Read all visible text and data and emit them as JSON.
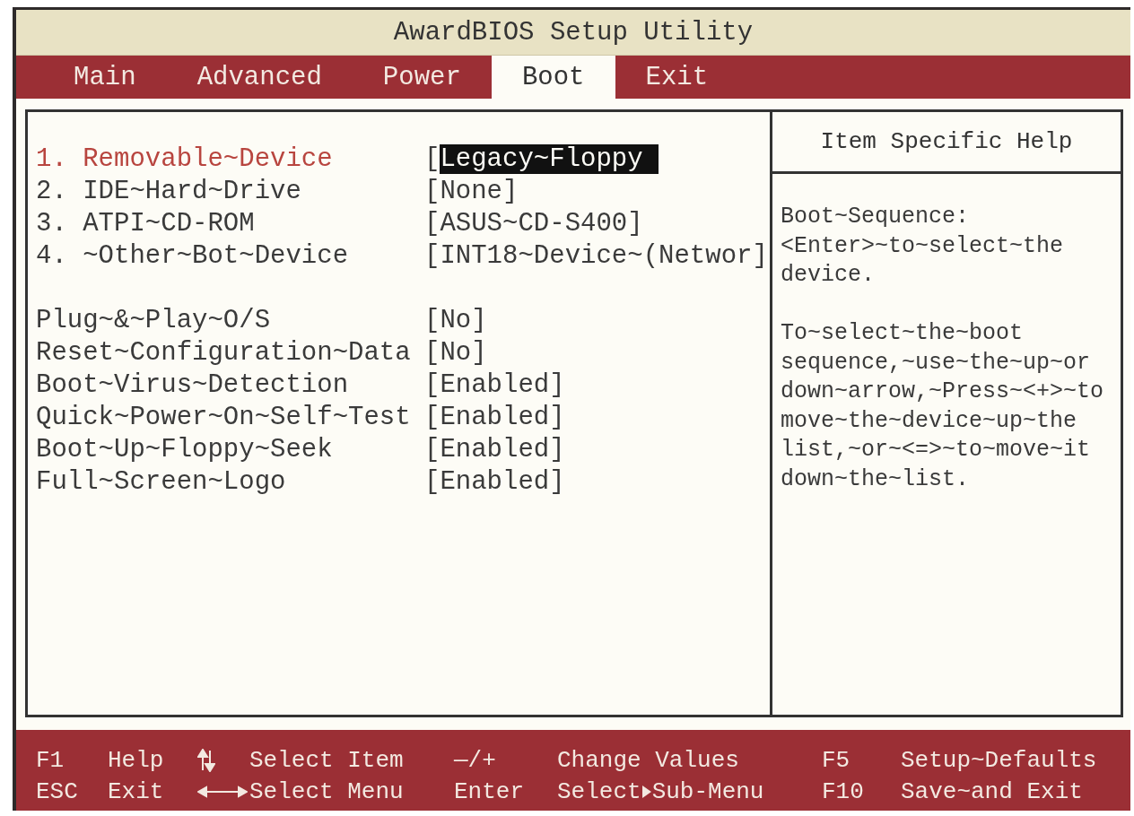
{
  "window": {
    "title": "AwardBIOS Setup Utility"
  },
  "tabs": [
    {
      "label": "Main",
      "selected": false
    },
    {
      "label": "Advanced",
      "selected": false
    },
    {
      "label": "Power",
      "selected": false
    },
    {
      "label": "Boot",
      "selected": true
    },
    {
      "label": "Exit",
      "selected": false
    }
  ],
  "settings": {
    "groups": [
      [
        {
          "label": "1. Removable~Device",
          "prefix": "[",
          "value": "Legacy~Floppy",
          "selected": true
        },
        {
          "label": "2. IDE~Hard~Drive",
          "value": "[None]",
          "selected": false
        },
        {
          "label": "3. ATPI~CD-ROM",
          "value": "[ASUS~CD-S400]",
          "selected": false
        },
        {
          "label": "4. ~Other~Bot~Device",
          "value": "[INT18~Device~(Networ]",
          "selected": false
        }
      ],
      [
        {
          "label": "Plug~&~Play~O/S",
          "value": "[No]",
          "selected": false
        },
        {
          "label": "Reset~Configuration~Data",
          "value": "[No]",
          "selected": false
        },
        {
          "label": "Boot~Virus~Detection",
          "value": "[Enabled]",
          "selected": false
        },
        {
          "label": "Quick~Power~On~Self~Test",
          "value": "[Enabled]",
          "selected": false
        },
        {
          "label": "Boot~Up~Floppy~Seek",
          "value": "[Enabled]",
          "selected": false
        },
        {
          "label": "Full~Screen~Logo",
          "value": "[Enabled]",
          "selected": false
        }
      ]
    ]
  },
  "help": {
    "title": "Item Specific Help",
    "paragraphs": [
      [
        "Boot~Sequence:",
        "<Enter>~to~select~the",
        "device."
      ],
      [
        "To~select~the~boot",
        "sequence,~use~the~up~or",
        "down~arrow,~Press~<+>~to",
        "move~the~device~up~the",
        "list,~or~<=>~to~move~it",
        "down~the~list."
      ]
    ]
  },
  "footer": {
    "rows": [
      [
        {
          "kind": "text",
          "key": "F1",
          "action": "Help"
        },
        {
          "kind": "arrows_vertical",
          "action": "Select Item"
        },
        {
          "kind": "text",
          "key": "—/+",
          "action": "Change Values"
        },
        {
          "kind": "text",
          "key": "F5",
          "action": "Setup~Defaults"
        }
      ],
      [
        {
          "kind": "text",
          "key": "ESC",
          "action": "Exit"
        },
        {
          "kind": "arrows_horizontal",
          "action": "Select Menu"
        },
        {
          "kind": "text",
          "key": "Enter",
          "action": "Select",
          "action_after": "Sub-Menu"
        },
        {
          "kind": "text",
          "key": "F10",
          "action": "Save~and Exit"
        }
      ]
    ]
  }
}
